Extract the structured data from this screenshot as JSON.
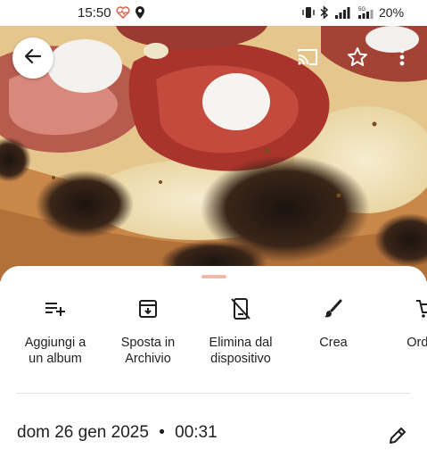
{
  "status_bar": {
    "time": "15:50",
    "battery_percent": "20%",
    "icons": [
      "heart-rate-icon",
      "location-icon",
      "vibrate-icon",
      "bluetooth-icon",
      "signal-icon",
      "5g-signal-icon",
      "battery-icon"
    ]
  },
  "viewer": {
    "back_icon": "arrow-left-icon",
    "cast_icon": "cast-icon",
    "favorite_icon": "star-outline-icon",
    "more_icon": "more-vert-icon"
  },
  "actions": [
    {
      "label": "Aggiungi a\nun album",
      "icon": "playlist-add-icon"
    },
    {
      "label": "Sposta in\nArchivio",
      "icon": "archive-icon"
    },
    {
      "label": "Elimina dal\ndispositivo",
      "icon": "delete-from-device-icon"
    },
    {
      "label": "Crea",
      "icon": "brush-icon"
    },
    {
      "label": "Ordina",
      "icon": "shopping-cart-icon"
    }
  ],
  "details": {
    "date": "dom 26 gen 2025",
    "separator": "•",
    "time": "00:31",
    "edit_icon": "pencil-icon"
  },
  "colors": {
    "sheet_handle": "#f2b8ab",
    "text": "#1f1f1f",
    "divider": "#e3e3e3"
  }
}
